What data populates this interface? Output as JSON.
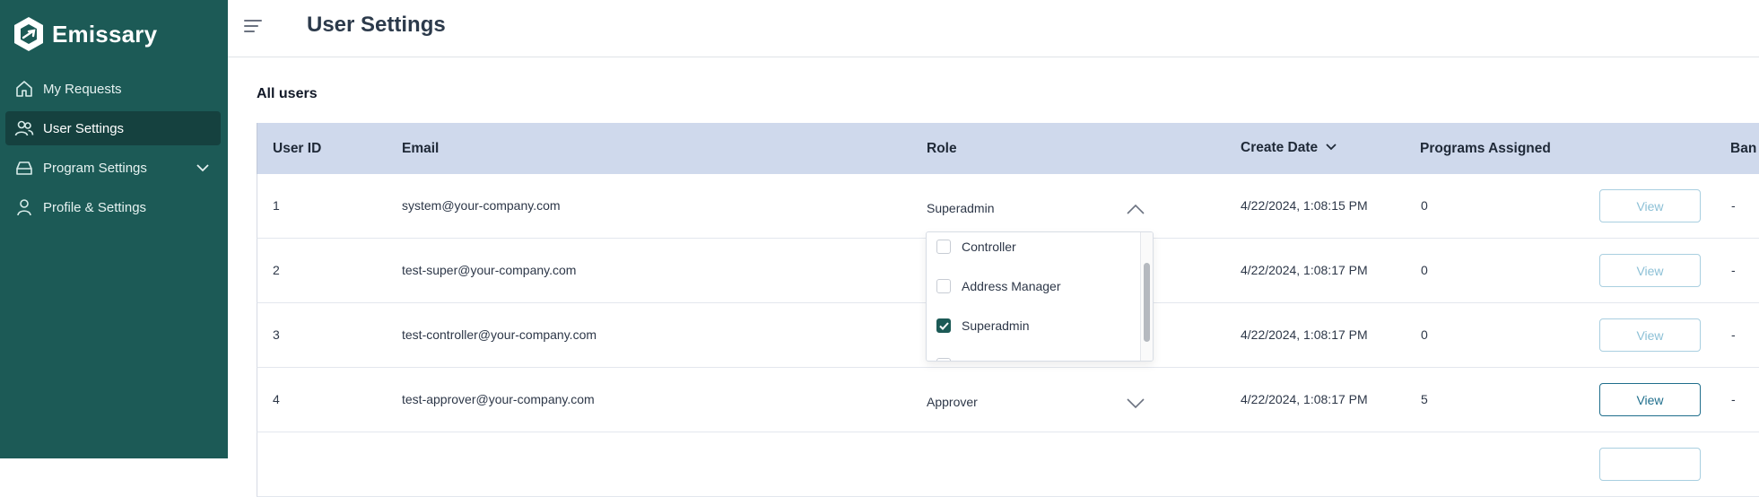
{
  "brand": {
    "name": "Emissary",
    "logo_icon": "emissary-logo"
  },
  "sidebar": {
    "items": [
      {
        "label": "My Requests",
        "icon": "home-icon"
      },
      {
        "label": "User Settings",
        "icon": "users-icon",
        "active": true
      },
      {
        "label": "Program Settings",
        "icon": "drive-icon",
        "has_chevron": true
      },
      {
        "label": "Profile & Settings",
        "icon": "person-icon"
      }
    ]
  },
  "header": {
    "title": "User Settings"
  },
  "section": {
    "title": "All users"
  },
  "table": {
    "columns": {
      "user_id": "User ID",
      "email": "Email",
      "role": "Role",
      "create_date": "Create Date",
      "programs": "Programs Assigned",
      "ban": "Ban"
    },
    "rows": [
      {
        "id": "1",
        "email": "system@your-company.com",
        "role": "Superadmin",
        "date": "4/22/2024, 1:08:15 PM",
        "programs": "0",
        "view": "View",
        "ban": "-"
      },
      {
        "id": "2",
        "email": "test-super@your-company.com",
        "role": "",
        "date": "4/22/2024, 1:08:17 PM",
        "programs": "0",
        "view": "View",
        "ban": "-"
      },
      {
        "id": "3",
        "email": "test-controller@your-company.com",
        "role": "",
        "date": "4/22/2024, 1:08:17 PM",
        "programs": "0",
        "view": "View",
        "ban": "-"
      },
      {
        "id": "4",
        "email": "test-approver@your-company.com",
        "role": "Approver",
        "date": "4/22/2024, 1:08:17 PM",
        "programs": "5",
        "view": "View",
        "ban": "-"
      }
    ]
  },
  "role_dropdown": {
    "options": [
      {
        "label": "Controller",
        "checked": false
      },
      {
        "label": "Address Manager",
        "checked": false
      },
      {
        "label": "Superadmin",
        "checked": true
      }
    ]
  },
  "colors": {
    "sidebar": "#1c5a56",
    "sidebar_active": "#15413f",
    "table_header": "#cfd9ec",
    "accent": "#1f6e8c"
  }
}
